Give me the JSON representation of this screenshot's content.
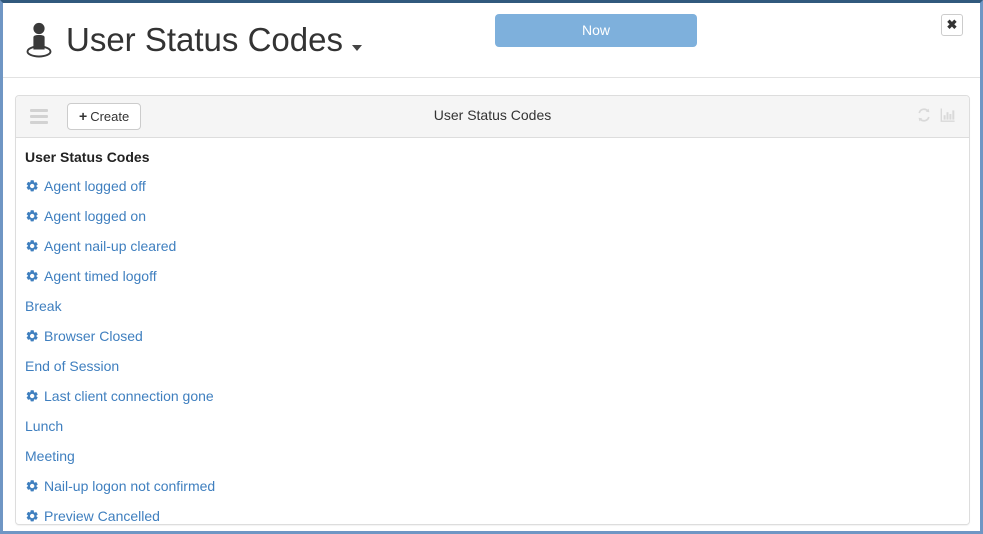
{
  "header": {
    "icon": "person-pin-icon",
    "title": "User Status Codes",
    "caret": "chevron-down-icon",
    "now_button_label": "Now",
    "close_button_label": "✖"
  },
  "panel": {
    "menu_icon": "hamburger-icon",
    "create_button_label": "Create",
    "create_button_plus": "+",
    "title": "User Status Codes",
    "actions": [
      {
        "name": "refresh-icon",
        "title": "Refresh"
      },
      {
        "name": "bar-chart-icon",
        "title": "Chart"
      }
    ],
    "list_heading": "User Status Codes",
    "items": [
      {
        "label": "Agent logged off",
        "gear": true
      },
      {
        "label": "Agent logged on",
        "gear": true
      },
      {
        "label": "Agent nail-up cleared",
        "gear": true
      },
      {
        "label": "Agent timed logoff",
        "gear": true
      },
      {
        "label": "Break",
        "gear": false
      },
      {
        "label": "Browser Closed",
        "gear": true
      },
      {
        "label": "End of Session",
        "gear": false
      },
      {
        "label": "Last client connection gone",
        "gear": true
      },
      {
        "label": "Lunch",
        "gear": false
      },
      {
        "label": "Meeting",
        "gear": false
      },
      {
        "label": "Nail-up logon not confirmed",
        "gear": true
      },
      {
        "label": "Preview Cancelled",
        "gear": true
      }
    ]
  },
  "colors": {
    "accent_blue": "#7eb0dc",
    "link_blue": "#3f7fbf",
    "window_border": "#6f96c4",
    "window_border_top": "#31597d",
    "toolbar_bg": "#f5f5f5"
  }
}
